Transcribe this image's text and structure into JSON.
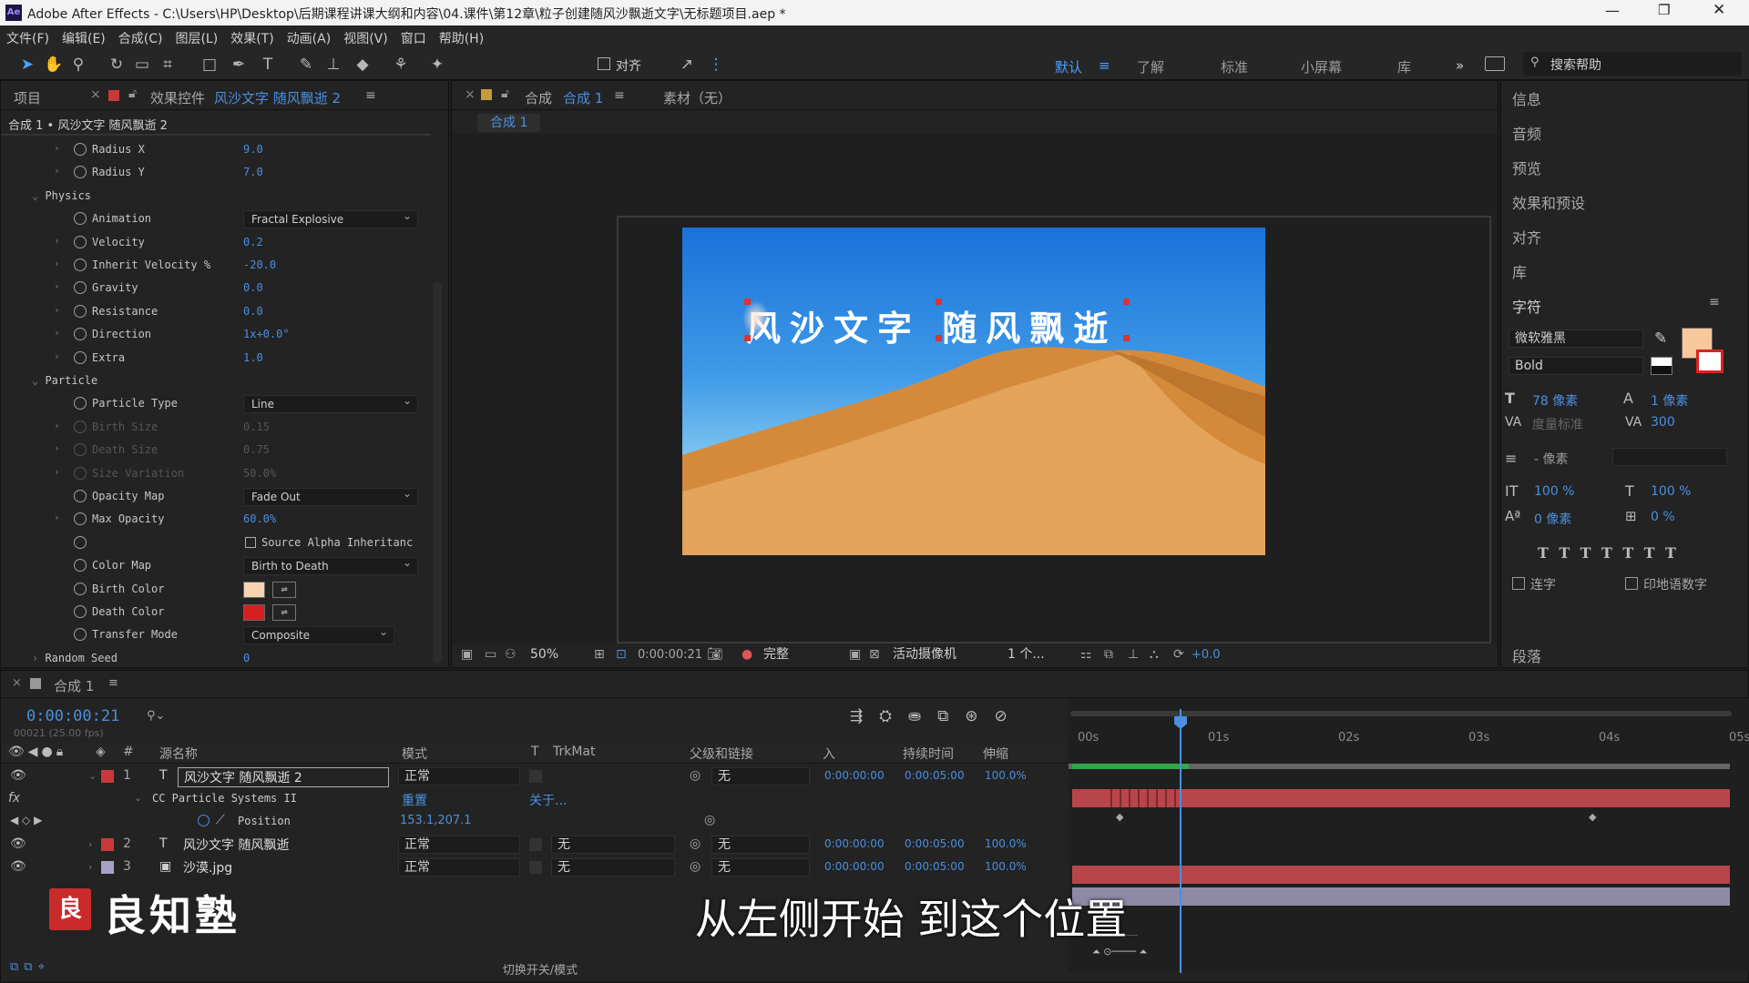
{
  "app": {
    "title": "Adobe After Effects - C:\\Users\\HP\\Desktop\\后期课程讲课大纲和内容\\04.课件\\第12章\\粒子创建随风沙飘逝文字\\无标题项目.aep *",
    "icon_label": "Ae"
  },
  "menu": [
    "文件(F)",
    "编辑(E)",
    "合成(C)",
    "图层(L)",
    "效果(T)",
    "动画(A)",
    "视图(V)",
    "窗口",
    "帮助(H)"
  ],
  "toolbar": {
    "align_label": "对齐",
    "workspaces": [
      "默认",
      "了解",
      "标准",
      "小屏幕",
      "库"
    ],
    "search_placeholder": "搜索帮助"
  },
  "effects_panel": {
    "tab_project": "项目",
    "tab_effects_prefix": "效果控件",
    "tab_effects_layer": "风沙文字 随风飘逝 2",
    "breadcrumb": "合成 1 • 风沙文字 随风飘逝 2",
    "props": [
      {
        "name": "Radius X",
        "value": "9.0"
      },
      {
        "name": "Radius Y",
        "value": "7.0"
      },
      {
        "group": "Physics"
      },
      {
        "name": "Animation",
        "dropdown": "Fractal Explosive"
      },
      {
        "name": "Velocity",
        "value": "0.2"
      },
      {
        "name": "Inherit Velocity %",
        "value": "-20.0"
      },
      {
        "name": "Gravity",
        "value": "0.0"
      },
      {
        "name": "Resistance",
        "value": "0.0"
      },
      {
        "name": "Direction",
        "value": "1x+0.0°"
      },
      {
        "name": "Extra",
        "value": "1.0"
      },
      {
        "group": "Particle"
      },
      {
        "name": "Particle Type",
        "dropdown": "Line"
      },
      {
        "name": "Birth Size",
        "value": "0.15",
        "disabled": true
      },
      {
        "name": "Death Size",
        "value": "0.75",
        "disabled": true
      },
      {
        "name": "Size Variation",
        "value": "50.0%",
        "disabled": true
      },
      {
        "name": "Opacity Map",
        "dropdown": "Fade Out"
      },
      {
        "name": "Max Opacity",
        "value": "60.0%"
      },
      {
        "name": "",
        "checkbox": "Source Alpha Inheritanc"
      },
      {
        "name": "Color Map",
        "dropdown": "Birth to Death"
      },
      {
        "name": "Birth Color",
        "color": "#f8d5b0"
      },
      {
        "name": "Death Color",
        "color": "#d42020"
      },
      {
        "name": "Transfer Mode",
        "dropdown": "Composite"
      },
      {
        "group": "Random Seed",
        "value": "0"
      }
    ]
  },
  "comp_panel": {
    "tab_label": "合成",
    "tab_comp": "合成 1",
    "footage_tab": "素材（无）",
    "comp_chip": "合成 1",
    "canvas_text": "风沙文字 随风飘逝",
    "bottom": {
      "zoom": "50%",
      "timecode": "0:00:00:21",
      "quality": "完整",
      "camera": "活动摄像机",
      "views": "1 个...",
      "offset": "+0.0"
    }
  },
  "right_panel": {
    "items": [
      "信息",
      "音频",
      "预览",
      "效果和预设",
      "对齐",
      "库"
    ],
    "char_title": "字符",
    "font": "微软雅黑",
    "style": "Bold",
    "size": "78 像素",
    "leading": "1 像素",
    "kerning": "度量标准",
    "tracking": "300",
    "stroke": "- 像素",
    "vscale": "100 %",
    "hscale": "100 %",
    "baseline": "0 像素",
    "tsume": "0 %",
    "ligature": "连字",
    "hindi": "印地语数字",
    "para": "段落",
    "fill_color": "#f8c79c"
  },
  "timeline": {
    "tab": "合成 1",
    "timecode": "0:00:00:21",
    "frame_info": "00021 (25.00 fps)",
    "headers": {
      "name": "源名称",
      "mode": "模式",
      "t": "T",
      "trkmat": "TrkMat",
      "parent": "父级和链接",
      "in": "入",
      "dur": "持续时间",
      "stretch": "伸缩"
    },
    "layers": [
      {
        "num": "1",
        "type": "T",
        "name": "风沙文字 随风飘逝 2",
        "mode": "正常",
        "trkmat": "",
        "parent": "无",
        "in": "0:00:00:00",
        "dur": "0:00:05:00",
        "stretch": "100.0%",
        "color": "#c83a3a"
      },
      {
        "num": "2",
        "type": "T",
        "name": "风沙文字 随风飘逝",
        "mode": "正常",
        "trkmat": "无",
        "parent": "无",
        "in": "0:00:00:00",
        "dur": "0:00:05:00",
        "stretch": "100.0%",
        "color": "#c83a3a"
      },
      {
        "num": "3",
        "type": "img",
        "name": "沙漠.jpg",
        "mode": "正常",
        "trkmat": "无",
        "parent": "无",
        "in": "0:00:00:00",
        "dur": "0:00:05:00",
        "stretch": "100.0%",
        "color": "#a9a0c8"
      }
    ],
    "effect_row": {
      "name": "CC Particle Systems II",
      "reset": "重置",
      "about": "关于..."
    },
    "position_row": {
      "name": "Position",
      "value": "153.1,207.1"
    },
    "ruler": [
      "00s",
      "01s",
      "02s",
      "03s",
      "04s",
      "05s"
    ],
    "footer": "切换开关/模式"
  },
  "overlay": {
    "logo_text": "良知塾",
    "subtitle": "从左侧开始 到这个位置"
  }
}
